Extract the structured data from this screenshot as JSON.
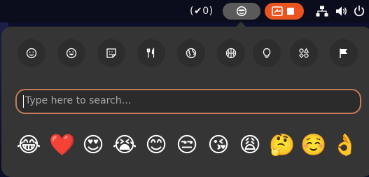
{
  "topbar": {
    "status_text": "(✔0)",
    "icons": [
      "face-icon",
      "screen-record-icon",
      "stop-icon",
      "network-icon",
      "volume-icon",
      "power-icon"
    ]
  },
  "emoji_picker": {
    "categories": [
      {
        "name": "smileys",
        "icon": "smiley-icon"
      },
      {
        "name": "people",
        "icon": "grin-icon"
      },
      {
        "name": "animals-nature",
        "icon": "sticker-icon"
      },
      {
        "name": "food-drink",
        "icon": "cutlery-icon"
      },
      {
        "name": "travel-places",
        "icon": "globe-icon"
      },
      {
        "name": "activities",
        "icon": "ball-icon"
      },
      {
        "name": "objects",
        "icon": "lightbulb-icon"
      },
      {
        "name": "symbols",
        "icon": "symbols-icon"
      },
      {
        "name": "flags",
        "icon": "flag-icon"
      }
    ],
    "search": {
      "placeholder": "Type here to search…",
      "value": ""
    },
    "recent": [
      "😂",
      "❤️",
      "😍",
      "😭",
      "😊",
      "😒",
      "😘",
      "😩",
      "🤔",
      "☺️",
      "👌"
    ]
  },
  "colors": {
    "accent": "#e95420",
    "search_border": "#c27b5c",
    "popover_bg": "#353535"
  }
}
